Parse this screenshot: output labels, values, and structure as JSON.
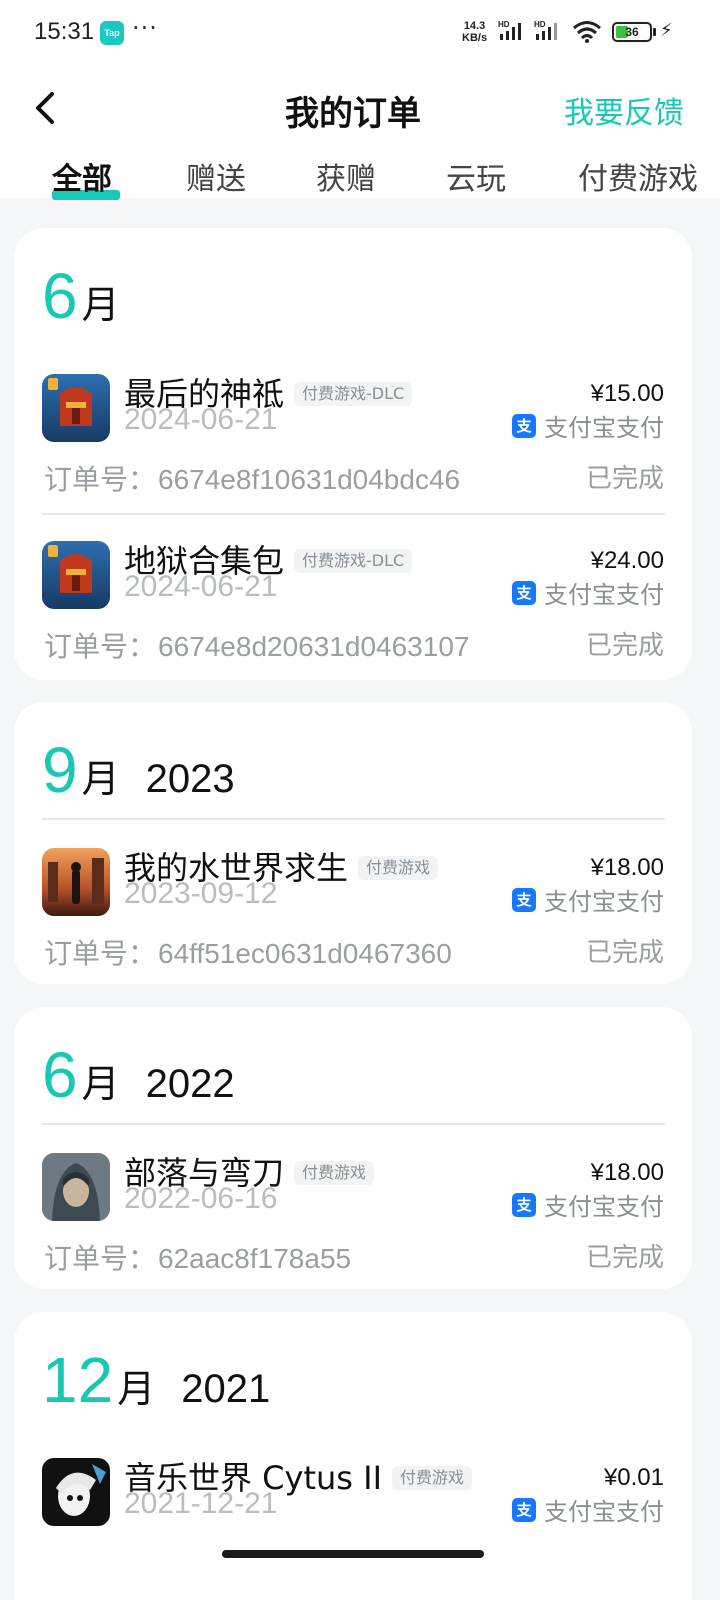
{
  "status_bar": {
    "time": "15:31",
    "tap_badge": "Tap",
    "more": "···",
    "net_speed_value": "14.3",
    "net_speed_unit": "KB/s",
    "battery": "36"
  },
  "header": {
    "title": "我的订单",
    "feedback": "我要反馈"
  },
  "tabs": [
    {
      "label": "全部",
      "active": true
    },
    {
      "label": "赠送",
      "active": false
    },
    {
      "label": "获赠",
      "active": false
    },
    {
      "label": "云玩",
      "active": false
    },
    {
      "label": "付费游戏",
      "active": false
    }
  ],
  "groups": [
    {
      "month": "6",
      "month_suffix": "月",
      "year": "",
      "orders": [
        {
          "name": "最后的神祗",
          "tag": "付费游戏-DLC",
          "date": "2024-06-21",
          "price": "¥15.00",
          "pay_method": "支付宝支付",
          "order_label": "订单号：",
          "order_no": "6674e8f10631d04bdc46",
          "status": "已完成"
        },
        {
          "name": "地狱合集包",
          "tag": "付费游戏-DLC",
          "date": "2024-06-21",
          "price": "¥24.00",
          "pay_method": "支付宝支付",
          "order_label": "订单号：",
          "order_no": "6674e8d20631d0463107",
          "status": "已完成"
        }
      ]
    },
    {
      "month": "9",
      "month_suffix": "月",
      "year": "2023",
      "orders": [
        {
          "name": "我的水世界求生",
          "tag": "付费游戏",
          "date": "2023-09-12",
          "price": "¥18.00",
          "pay_method": "支付宝支付",
          "order_label": "订单号：",
          "order_no": "64ff51ec0631d0467360",
          "status": "已完成"
        }
      ]
    },
    {
      "month": "6",
      "month_suffix": "月",
      "year": "2022",
      "orders": [
        {
          "name": "部落与弯刀",
          "tag": "付费游戏",
          "date": "2022-06-16",
          "price": "¥18.00",
          "pay_method": "支付宝支付",
          "order_label": "订单号：",
          "order_no": "62aac8f178a55",
          "status": "已完成"
        }
      ]
    },
    {
      "month": "12",
      "month_suffix": "月",
      "year": "2021",
      "orders": [
        {
          "name": "音乐世界 Cytus II",
          "tag": "付费游戏",
          "date": "2021-12-21",
          "price": "¥0.01",
          "pay_method": "支付宝支付"
        }
      ]
    }
  ],
  "colors": {
    "accent": "#19c8b4",
    "alipay": "#1677ff",
    "page_bg": "#f4f6f8"
  }
}
